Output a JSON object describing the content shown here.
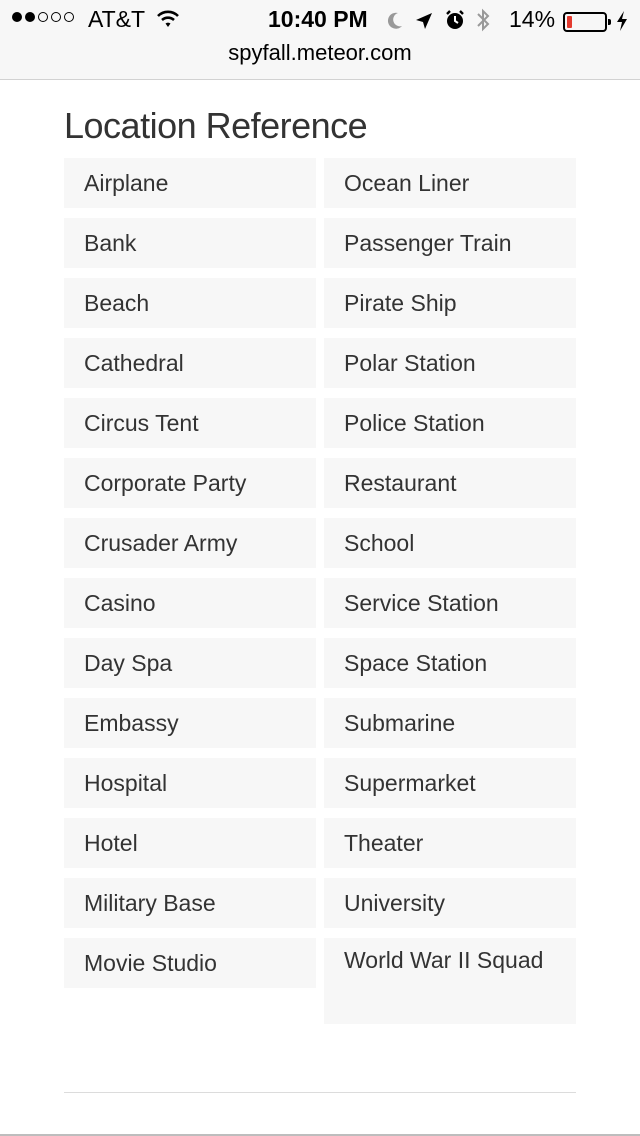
{
  "status_bar": {
    "carrier": "AT&T",
    "time": "10:40 PM",
    "battery": "14%",
    "battery_level": 0.14,
    "signal_bars_filled": 2,
    "signal_bars_total": 5,
    "icons": [
      "wifi-icon",
      "moon-icon",
      "location-arrow-icon",
      "alarm-icon",
      "bluetooth-icon",
      "charging-bolt-icon"
    ]
  },
  "browser": {
    "url": "spyfall.meteor.com"
  },
  "page": {
    "title": "Location Reference",
    "locations_left": [
      "Airplane",
      "Bank",
      "Beach",
      "Cathedral",
      "Circus Tent",
      "Corporate Party",
      "Crusader Army",
      "Casino",
      "Day Spa",
      "Embassy",
      "Hospital",
      "Hotel",
      "Military Base",
      "Movie Studio"
    ],
    "locations_right": [
      "Ocean Liner",
      "Passenger Train",
      "Pirate Ship",
      "Polar Station",
      "Police Station",
      "Restaurant",
      "School",
      "Service Station",
      "Space Station",
      "Submarine",
      "Supermarket",
      "Theater",
      "University",
      "World War II Squad"
    ]
  },
  "colors": {
    "cell_background": "#f7f7f7",
    "text": "#333333",
    "battery_low": "#e33a2f"
  }
}
